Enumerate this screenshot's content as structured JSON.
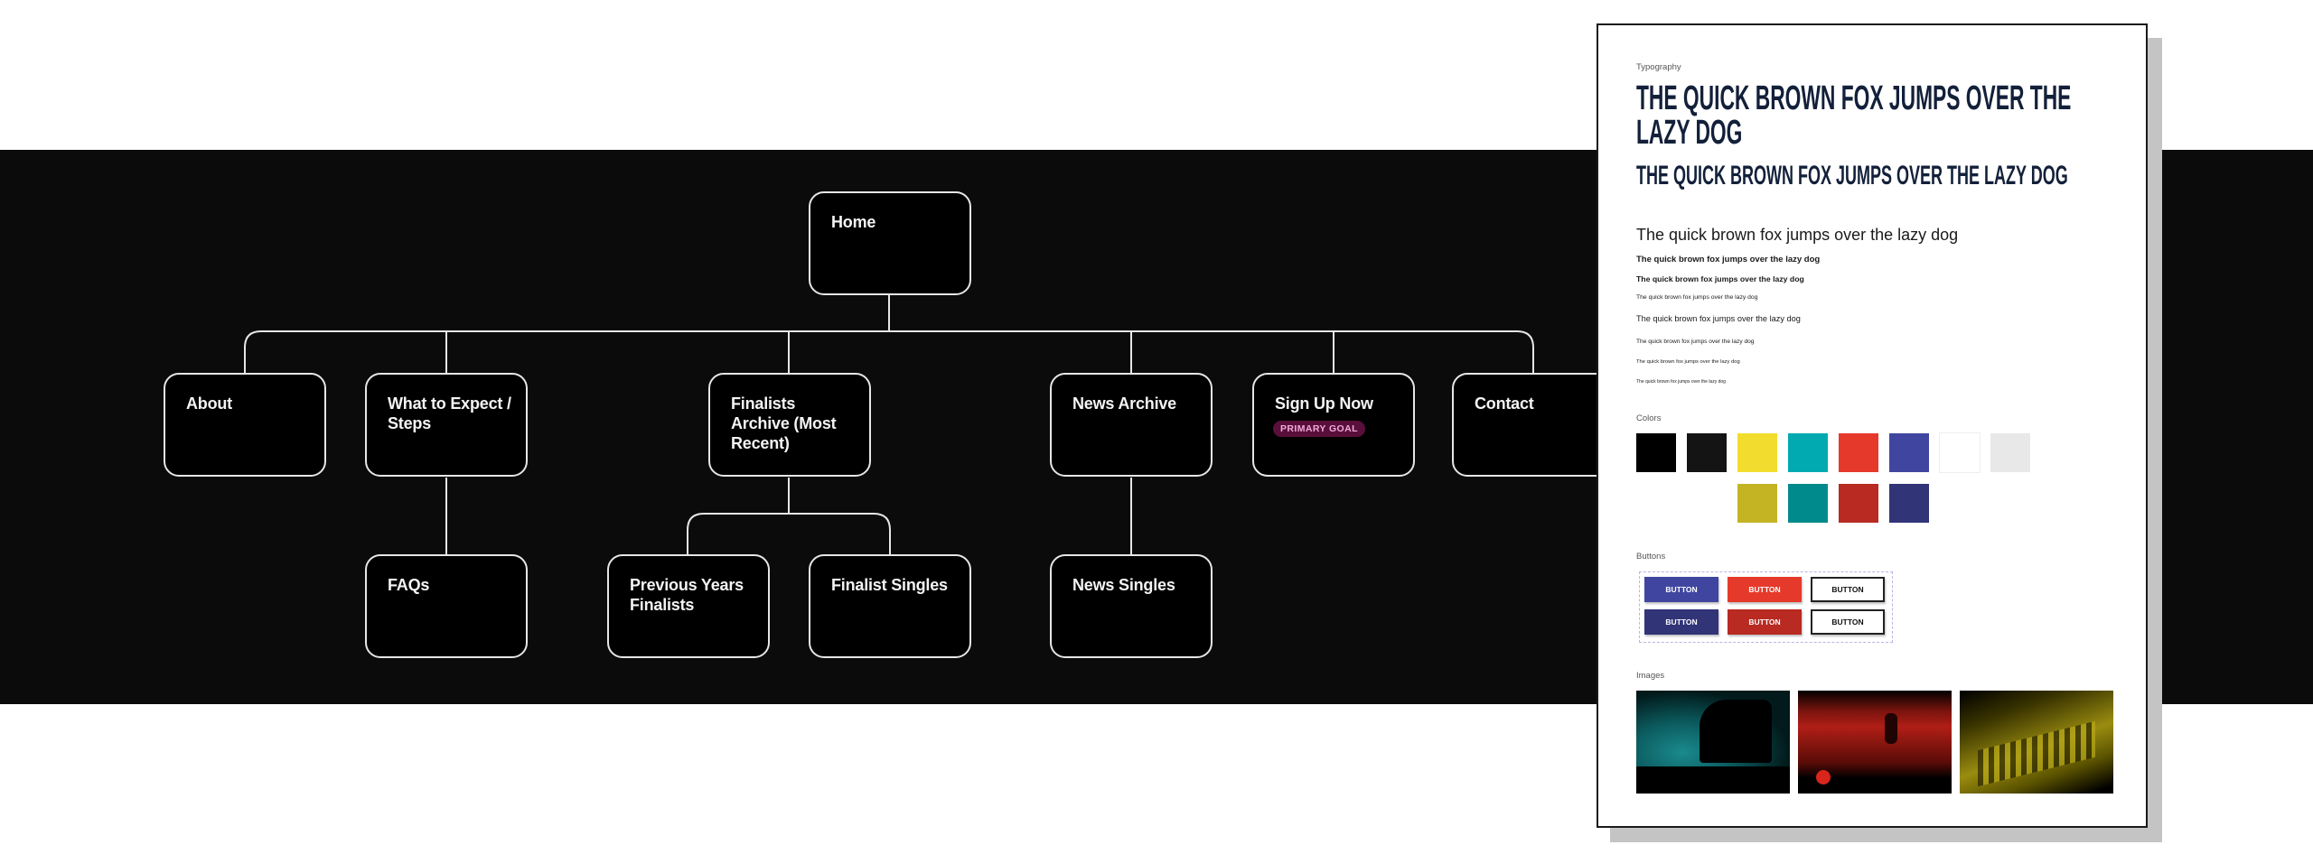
{
  "sitemap": {
    "home": "Home",
    "level1": [
      {
        "label": "About"
      },
      {
        "label": "What to Expect / Steps"
      },
      {
        "label": "Finalists Archive (Most Recent)"
      },
      {
        "label": "News Archive"
      },
      {
        "label": "Sign Up Now",
        "badge": "PRIMARY GOAL"
      },
      {
        "label": "Contact"
      }
    ],
    "level2": [
      {
        "label": "FAQs",
        "parent": "What to Expect / Steps"
      },
      {
        "label": "Previous Years Finalists",
        "parent": "Finalists Archive (Most Recent)"
      },
      {
        "label": "Finalist Singles",
        "parent": "Finalists Archive (Most Recent)"
      },
      {
        "label": "News Singles",
        "parent": "News Archive"
      }
    ]
  },
  "style_guide": {
    "typography": {
      "label": "Typography",
      "samples": [
        "THE QUICK BROWN FOX JUMPS OVER THE LAZY DOG",
        "THE QUICK BROWN FOX JUMPS OVER THE LAZY DOG",
        "The quick brown fox jumps over the lazy dog",
        "The quick brown fox jumps over the lazy dog",
        "The quick brown fox jumps over the lazy dog",
        "The quick brown fox jumps over the lazy dog",
        "The quick brown fox jumps over the lazy dog",
        "The quick brown fox jumps over the lazy dog",
        "The quick brown fox jumps over the lazy dog",
        "The quick brown fox jumps over the lazy dog"
      ]
    },
    "colors": {
      "label": "Colors",
      "row1": [
        "#000000",
        "#141414",
        "#f2dd2e",
        "#00aab0",
        "#e53a2b",
        "#4046a0",
        "#ffffff",
        "#e8e8e8"
      ],
      "row2": [
        "#c4b424",
        "#008a8c",
        "#b82a22",
        "#323478"
      ]
    },
    "buttons": {
      "label": "Buttons",
      "items": [
        "BUTTON",
        "BUTTON",
        "BUTTON",
        "BUTTON",
        "BUTTON",
        "BUTTON"
      ]
    },
    "images": {
      "label": "Images",
      "tints": [
        "#00a3a8",
        "#c8261c",
        "#c9b81a"
      ]
    }
  }
}
